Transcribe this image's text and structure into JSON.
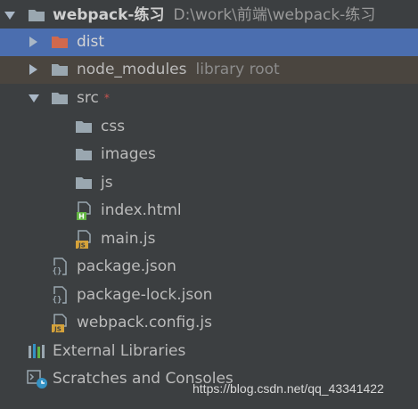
{
  "project": {
    "name": "webpack-练习",
    "path": "D:\\work\\前端\\webpack-练习"
  },
  "items": {
    "dist": {
      "label": "dist"
    },
    "node_modules": {
      "label": "node_modules",
      "hint": "library root"
    },
    "src": {
      "label": "src",
      "marker": "*"
    },
    "css": {
      "label": "css"
    },
    "images": {
      "label": "images"
    },
    "js": {
      "label": "js"
    },
    "index_html": {
      "label": "index.html"
    },
    "main_js": {
      "label": "main.js"
    },
    "package_json": {
      "label": "package.json"
    },
    "package_lock_json": {
      "label": "package-lock.json"
    },
    "webpack_config_js": {
      "label": "webpack.config.js"
    },
    "external_libraries": {
      "label": "External Libraries"
    },
    "scratches": {
      "label": "Scratches and Consoles"
    }
  },
  "icons": {
    "html_badge": "H",
    "js_badge": "JS",
    "json_badge": "{}"
  },
  "colors": {
    "background": "#3c3f41",
    "selection": "#4b6eaf",
    "excluded_row": "#4a453f",
    "folder": "#9aa7b0",
    "excluded_folder": "#d0694e",
    "modified_marker": "#c75450"
  },
  "watermark": "https://blog.csdn.net/qq_43341422"
}
